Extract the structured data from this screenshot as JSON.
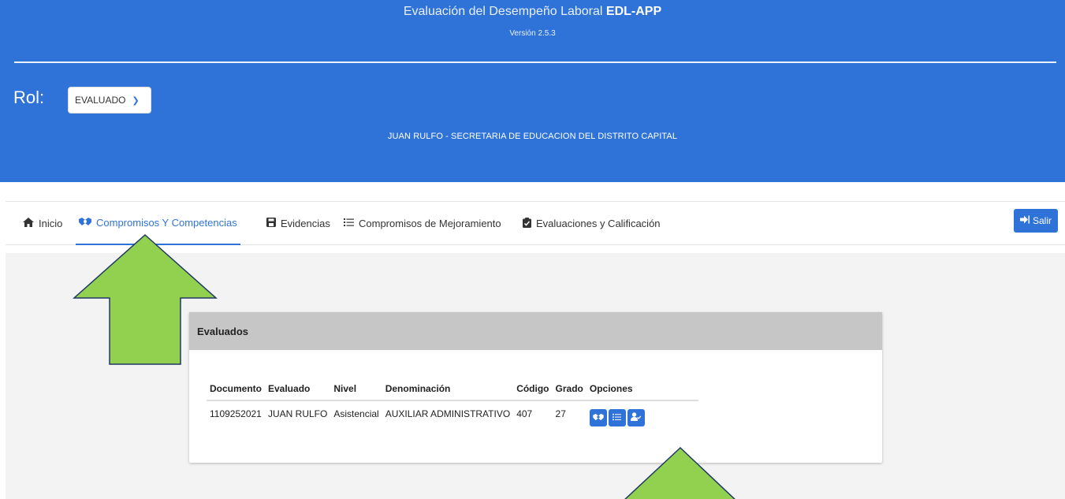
{
  "header": {
    "title_prefix": "Evaluación del Desempeño Laboral",
    "title_app": "EDL-APP",
    "version": "Versión 2.5.3",
    "rol_label": "Rol:",
    "rol_value": "EVALUADO",
    "user_line": "JUAN RULFO - SECRETARIA DE EDUCACION DEL DISTRITO CAPITAL",
    "background_color": "#2f73d8"
  },
  "nav": {
    "items": [
      {
        "label": "Inicio",
        "icon": "home-icon"
      },
      {
        "label": "Compromisos Y Competencias",
        "icon": "handshake-icon",
        "active": true
      },
      {
        "label": "Evidencias",
        "icon": "save-icon"
      },
      {
        "label": "Compromisos de Mejoramiento",
        "icon": "list-icon"
      },
      {
        "label": "Evaluaciones y Calificación",
        "icon": "clipboard-check-icon"
      }
    ],
    "salir_label": "Salir",
    "accent_color": "#2f73d8"
  },
  "card": {
    "title": "Evaluados",
    "columns": [
      "Documento",
      "Evaluado",
      "Nivel",
      "Denominación",
      "Código",
      "Grado",
      "Opciones"
    ],
    "rows": [
      [
        "1109252021",
        "JUAN RULFO",
        "Asistencial",
        "AUXILIAR ADMINISTRATIVO",
        "407",
        "27"
      ]
    ],
    "option_icons": [
      "handshake-icon",
      "list-icon",
      "user-check-icon"
    ]
  },
  "annotations": {
    "arrow_color": "#92d050"
  }
}
